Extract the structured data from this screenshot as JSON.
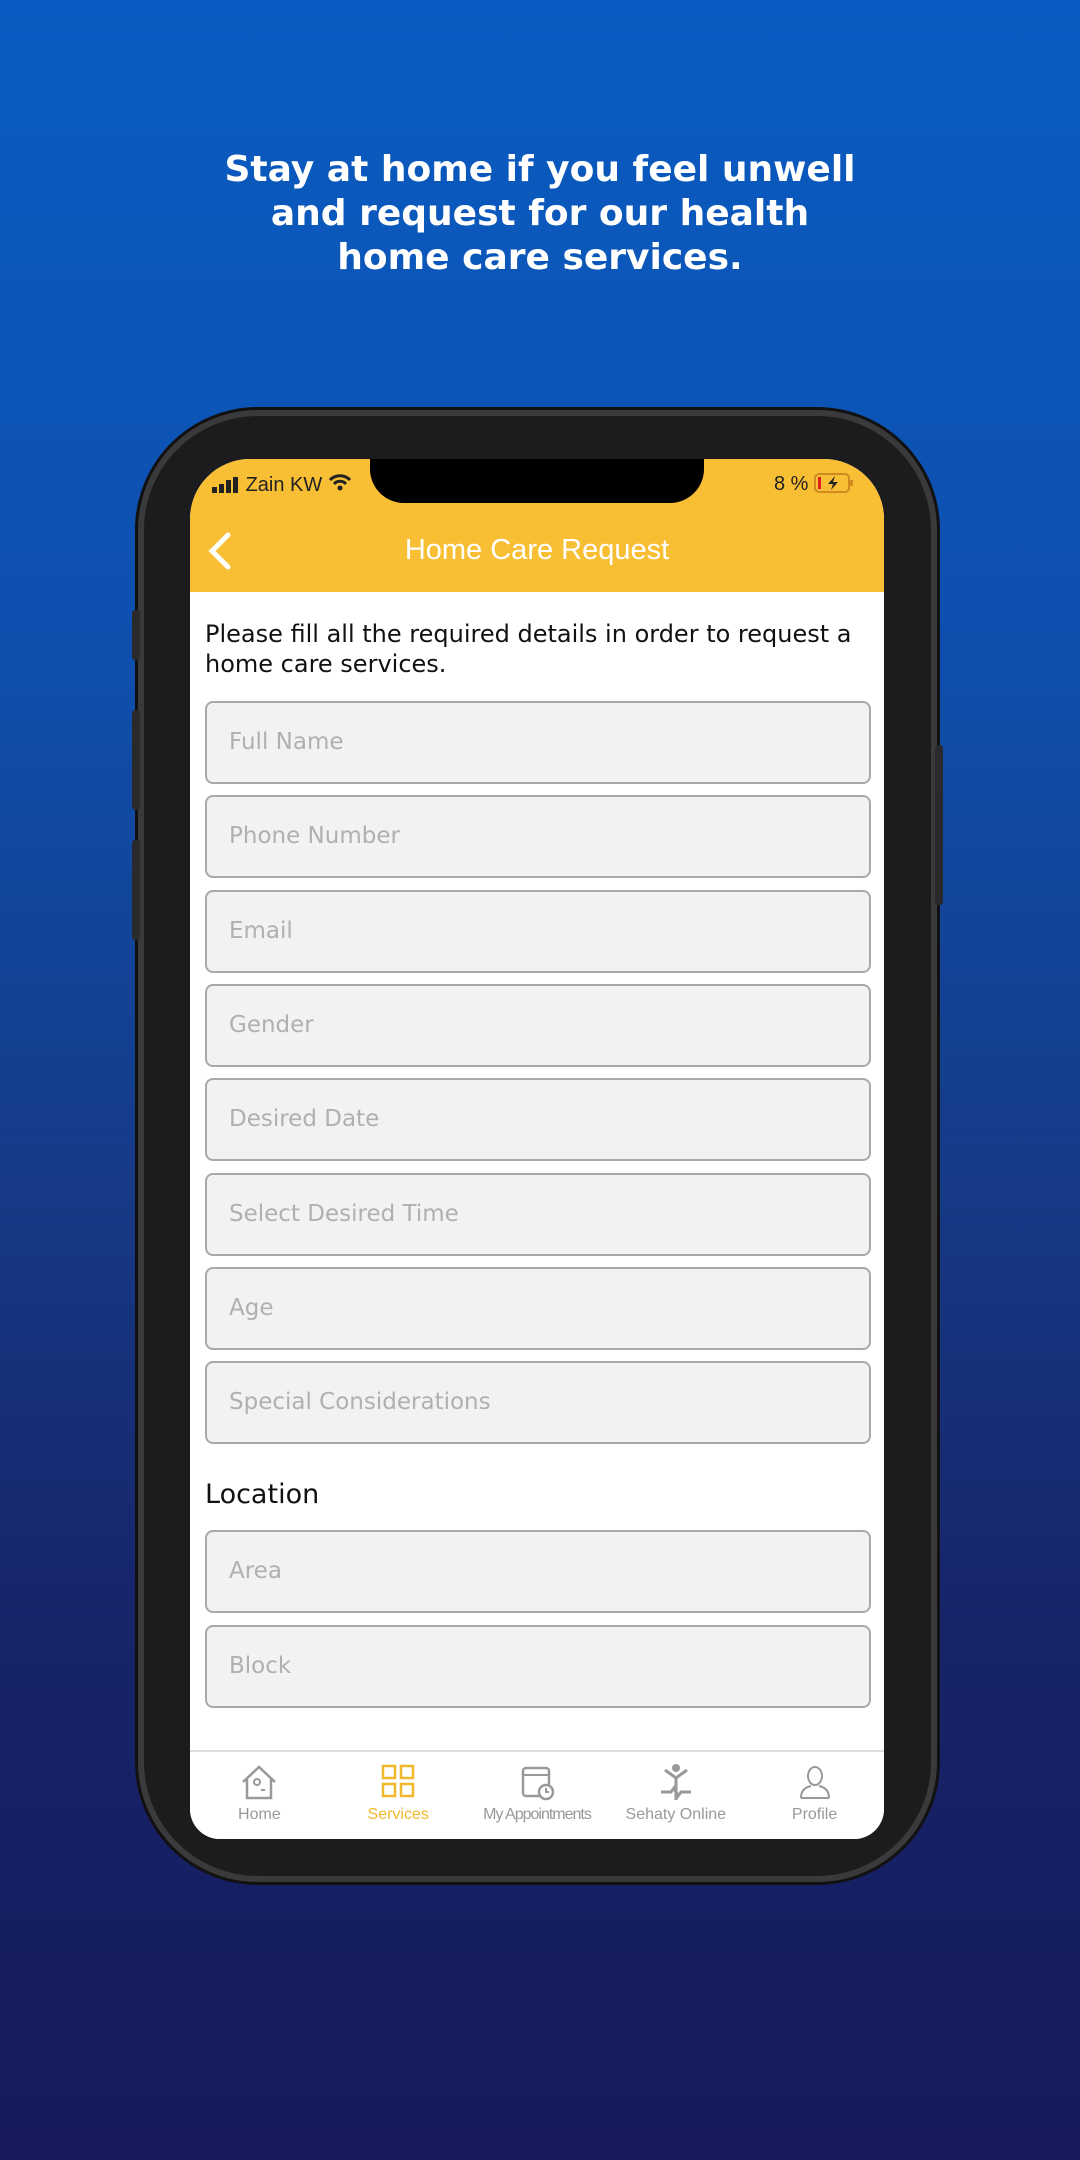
{
  "headline": [
    "Stay at home if you feel unwell",
    "and request for our health",
    "home care services."
  ],
  "status": {
    "carrier": "Zain KW",
    "battery": "8 %"
  },
  "header": {
    "title": "Home Care Request"
  },
  "intro": "Please fill all the required details in order to request a  home care services.",
  "fields": [
    "Full Name",
    "Phone Number",
    "Email",
    "Gender",
    "Desired Date",
    "Select Desired Time",
    "Age",
    "Special Considerations"
  ],
  "location": {
    "label": "Location",
    "fields": [
      "Area",
      "Block"
    ]
  },
  "tabs": [
    {
      "label": "Home",
      "icon": "home-icon"
    },
    {
      "label": "Services",
      "icon": "grid-icon",
      "active": true
    },
    {
      "label": "My Appointments",
      "icon": "calendar-clock-icon"
    },
    {
      "label": "Sehaty Online",
      "icon": "person-pulse-icon"
    },
    {
      "label": "Profile",
      "icon": "user-icon"
    }
  ],
  "colors": {
    "accent": "#f8bf35",
    "active_tab": "#f2b82c"
  }
}
